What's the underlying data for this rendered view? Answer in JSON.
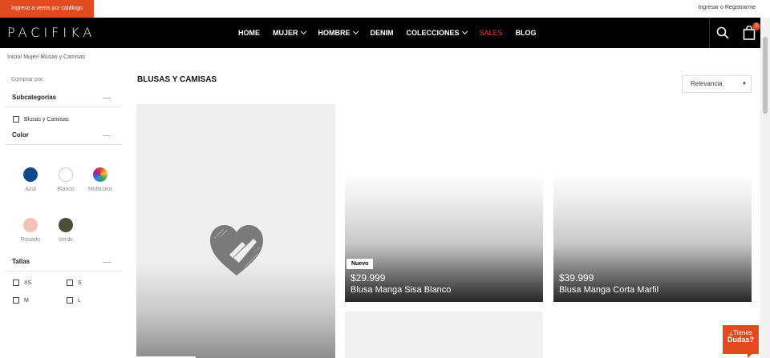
{
  "topbar": {
    "promo_label": "Ingreso a venta por catálogo",
    "login_label": "Ingresar o Registrarme"
  },
  "nav": {
    "logo": "PACIFIKA",
    "items": [
      {
        "label": "HOME",
        "dropdown": false
      },
      {
        "label": "MUJER",
        "dropdown": true
      },
      {
        "label": "HOMBRE",
        "dropdown": true
      },
      {
        "label": "DENIM",
        "dropdown": false
      },
      {
        "label": "COLECCIONES",
        "dropdown": true
      },
      {
        "label": "SALES",
        "dropdown": false
      },
      {
        "label": "BLOG",
        "dropdown": false
      }
    ],
    "cart_count": "3",
    "sales_color": "#e14b1f"
  },
  "breadcrumb": "Inicio/ Mujer/ Blusas y Camisas",
  "sidebar": {
    "shop_by": "Comprar por:",
    "subcategories_title": "Subcategorías",
    "subcategories": [
      "Blusas y Camisas"
    ],
    "color_title": "Color",
    "colors": [
      {
        "label": "Azul",
        "hex": "#0d4a8a"
      },
      {
        "label": "Blanco",
        "hex": "#ffffff"
      },
      {
        "label": "Multicolor",
        "hex": "multicolor"
      },
      {
        "label": "Rosado",
        "hex": "#f3c2b6"
      },
      {
        "label": "Verde",
        "hex": "#4a4f3a"
      }
    ],
    "sizes_title": "Tallas",
    "sizes": [
      "XS",
      "S",
      "M",
      "L"
    ]
  },
  "main": {
    "title": "BLUSAS Y CAMISAS",
    "sort_label": "Relevancia",
    "products": [
      {
        "badge": "Nuevo",
        "price": "$29.999",
        "name": "Blusa Manga Sisa Blanco"
      },
      {
        "badge": "",
        "price": "$39.999",
        "name": "Blusa Manga Corta Marfil"
      }
    ]
  },
  "help": {
    "line1": "¿Tienes",
    "line2": "Dudas?"
  }
}
